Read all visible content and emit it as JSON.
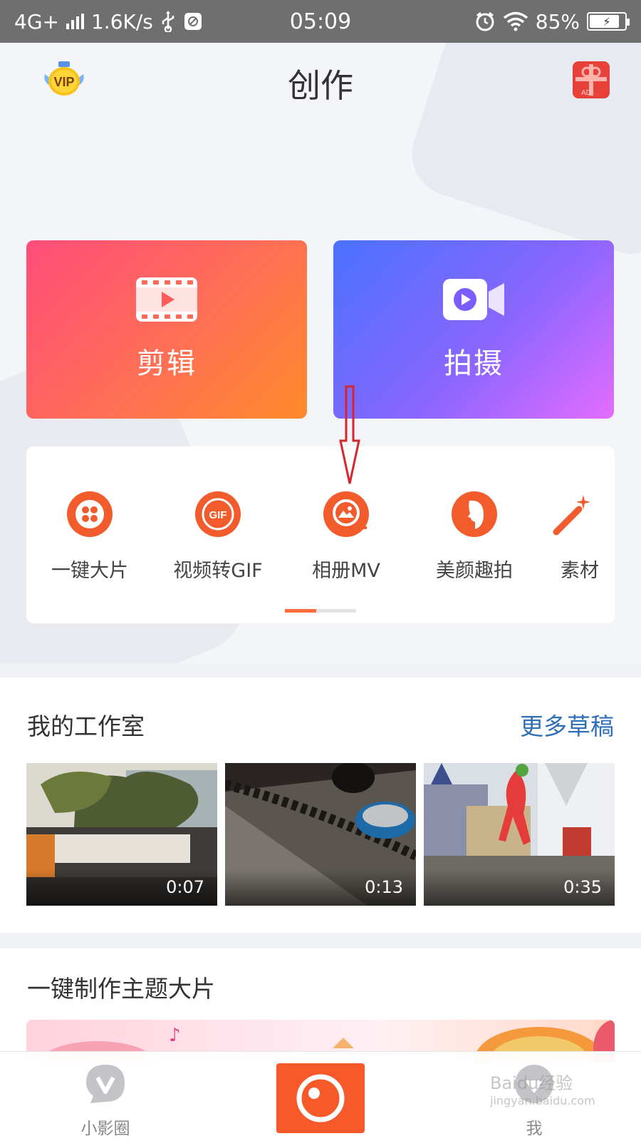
{
  "status_bar": {
    "network": "4G+",
    "speed": "1.6K/s",
    "time": "05:09",
    "battery_percent": "85%",
    "battery_level": 0.85
  },
  "header": {
    "title": "创作",
    "vip_text": "VIP",
    "ad_text": "AD"
  },
  "cards": {
    "edit_label": "剪辑",
    "shoot_label": "拍摄"
  },
  "tools": [
    {
      "label": "一键大片",
      "icon": "film-reel-icon"
    },
    {
      "label": "视频转GIF",
      "icon": "gif-icon"
    },
    {
      "label": "相册MV",
      "icon": "album-mv-icon"
    },
    {
      "label": "美颜趣拍",
      "icon": "beauty-face-icon"
    },
    {
      "label": "素材",
      "icon": "magic-wand-icon"
    }
  ],
  "studio": {
    "title": "我的工作室",
    "more_label": "更多草稿",
    "drafts": [
      {
        "duration": "0:07"
      },
      {
        "duration": "0:13"
      },
      {
        "duration": "0:35"
      }
    ]
  },
  "theme": {
    "title": "一键制作主题大片"
  },
  "bottom_nav": {
    "left_label": "小影圈",
    "right_label": "我",
    "watermark_line1": "Baidu经验",
    "watermark_line2": "jingyan.baidu.com"
  },
  "colors": {
    "accent": "#f65a2b",
    "link": "#2f6fb8",
    "tool_icon": "#f25c2d"
  }
}
